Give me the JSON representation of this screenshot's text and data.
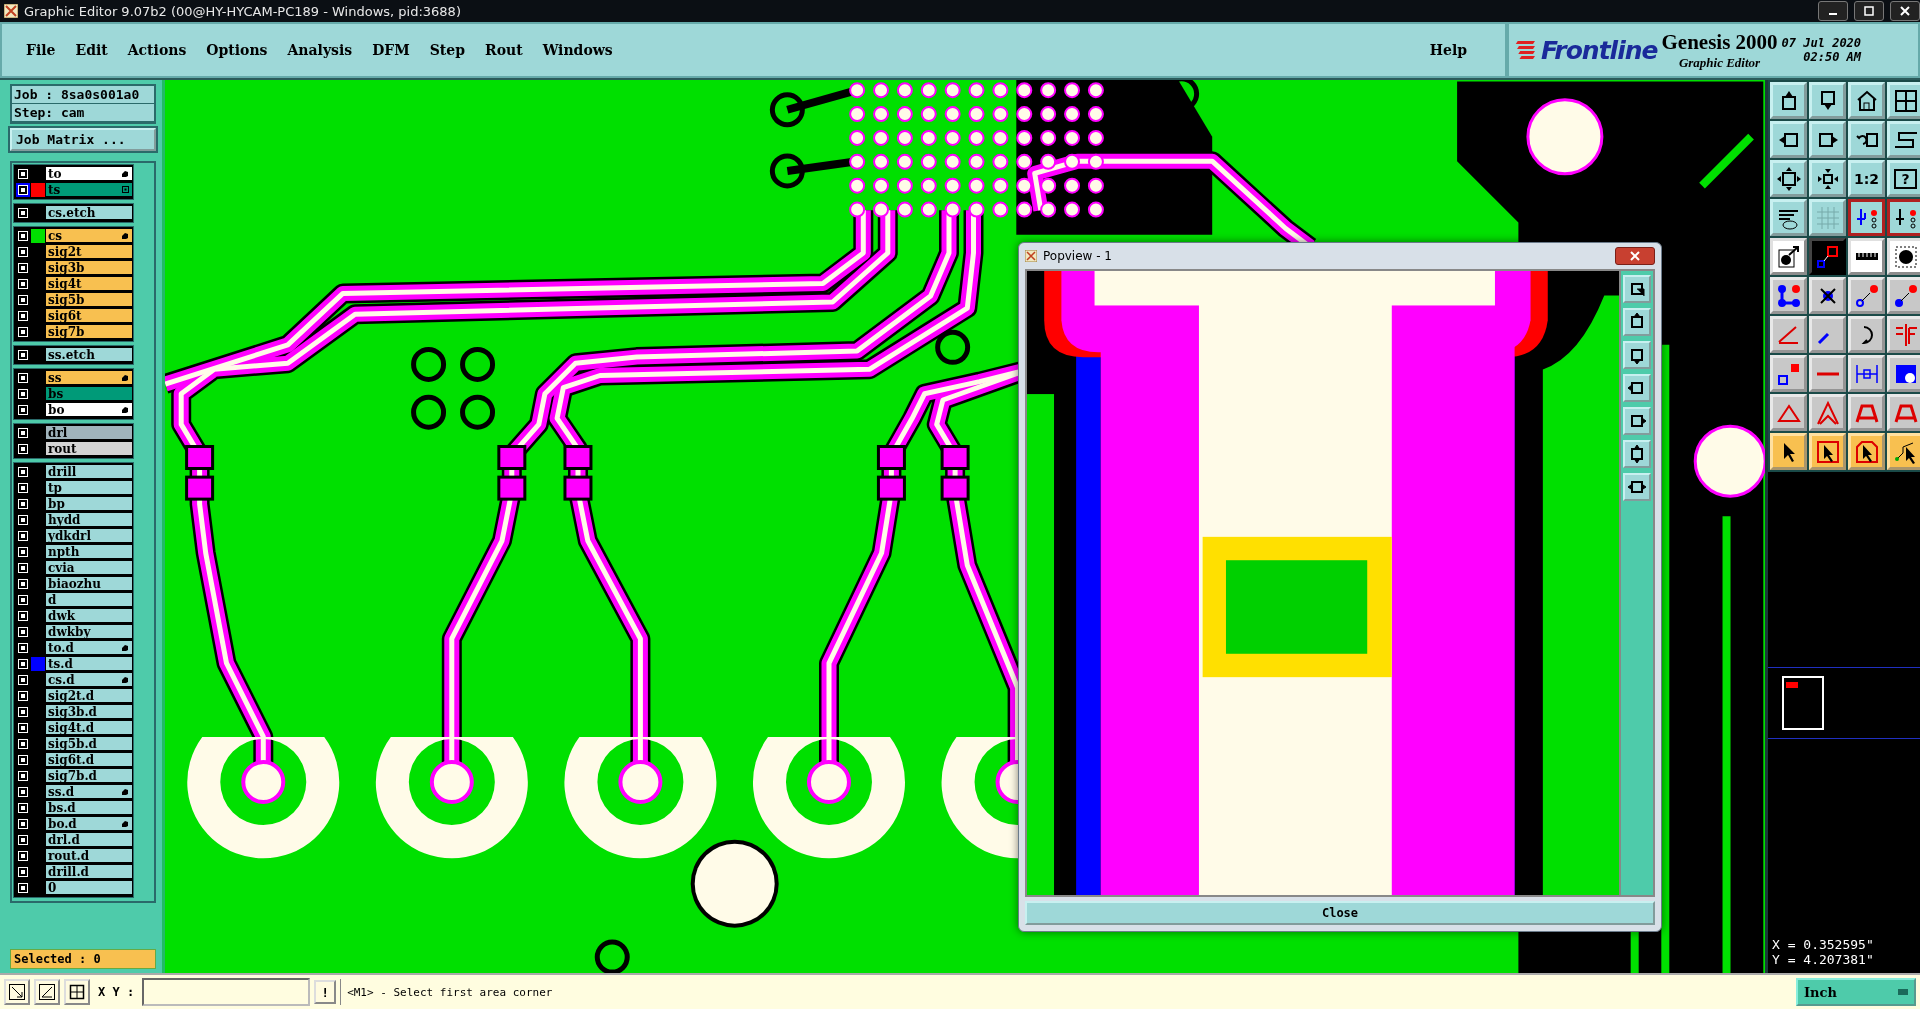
{
  "window": {
    "title": "Graphic Editor 9.07b2 (00@HY-HYCAM-PC189 - Windows, pid:3688)"
  },
  "menu": [
    "File",
    "Edit",
    "Actions",
    "Options",
    "Analysis",
    "DFM",
    "Step",
    "Rout",
    "Windows"
  ],
  "help_menu": "Help",
  "brand": {
    "logo": "Frontline",
    "product": "Genesis 2000",
    "subtitle": "Graphic Editor",
    "date": "07 Jul 2020",
    "time": "02:50 AM"
  },
  "job": {
    "job": "Job : 8sa0s001a0",
    "step": "Step: cam",
    "matrix_button": "Job Matrix ..."
  },
  "layer_groups": [
    {
      "layers": [
        {
          "name": "to",
          "kind": "silk",
          "checked": false,
          "selected": false,
          "hand": true,
          "grid_mark": false
        },
        {
          "name": "ts",
          "kind": "mask",
          "checked": false,
          "selected": true,
          "hand": false,
          "grid_mark": true,
          "color": "#ff0000"
        }
      ]
    },
    {
      "layers": [
        {
          "name": "cs.etch",
          "kind": "misc",
          "checked": false,
          "selected": false,
          "hand": false,
          "grid_mark": false
        }
      ]
    },
    {
      "layers": [
        {
          "name": "cs",
          "kind": "signal",
          "checked": false,
          "selected": false,
          "hand": true,
          "grid_mark": false,
          "color": "#00e000"
        },
        {
          "name": "sig2t",
          "kind": "signal",
          "checked": false,
          "selected": false,
          "hand": false,
          "grid_mark": false
        },
        {
          "name": "sig3b",
          "kind": "signal",
          "checked": false,
          "selected": false,
          "hand": false,
          "grid_mark": false
        },
        {
          "name": "sig4t",
          "kind": "signal",
          "checked": false,
          "selected": false,
          "hand": false,
          "grid_mark": false
        },
        {
          "name": "sig5b",
          "kind": "signal",
          "checked": false,
          "selected": false,
          "hand": false,
          "grid_mark": false
        },
        {
          "name": "sig6t",
          "kind": "signal",
          "checked": false,
          "selected": false,
          "hand": false,
          "grid_mark": false
        },
        {
          "name": "sig7b",
          "kind": "signal",
          "checked": false,
          "selected": false,
          "hand": false,
          "grid_mark": false
        }
      ]
    },
    {
      "layers": [
        {
          "name": "ss.etch",
          "kind": "misc",
          "checked": false,
          "selected": false,
          "hand": false,
          "grid_mark": false
        }
      ]
    },
    {
      "layers": [
        {
          "name": "ss",
          "kind": "signal",
          "checked": false,
          "selected": false,
          "hand": true,
          "grid_mark": false
        },
        {
          "name": "bs",
          "kind": "mask",
          "checked": false,
          "selected": false,
          "hand": false,
          "grid_mark": false
        },
        {
          "name": "bo",
          "kind": "silk",
          "checked": false,
          "selected": false,
          "hand": true,
          "grid_mark": false
        }
      ]
    },
    {
      "layers": [
        {
          "name": "drl",
          "kind": "drill",
          "checked": false,
          "selected": false,
          "hand": false,
          "grid_mark": false
        },
        {
          "name": "rout",
          "kind": "rout",
          "checked": false,
          "selected": false,
          "hand": false,
          "grid_mark": false
        }
      ]
    },
    {
      "layers": [
        {
          "name": "drill",
          "kind": "misc",
          "checked": false,
          "selected": false,
          "hand": false,
          "grid_mark": false
        },
        {
          "name": "tp",
          "kind": "misc",
          "checked": false,
          "selected": false,
          "hand": false,
          "grid_mark": false
        },
        {
          "name": "bp",
          "kind": "misc",
          "checked": false,
          "selected": false,
          "hand": false,
          "grid_mark": false
        },
        {
          "name": "hydd",
          "kind": "misc",
          "checked": false,
          "selected": false,
          "hand": false,
          "grid_mark": false
        },
        {
          "name": "ydkdrl",
          "kind": "misc",
          "checked": false,
          "selected": false,
          "hand": false,
          "grid_mark": false
        },
        {
          "name": "npth",
          "kind": "misc",
          "checked": false,
          "selected": false,
          "hand": false,
          "grid_mark": false
        },
        {
          "name": "cvia",
          "kind": "misc",
          "checked": false,
          "selected": false,
          "hand": false,
          "grid_mark": false
        },
        {
          "name": "biaozhu",
          "kind": "misc",
          "checked": false,
          "selected": false,
          "hand": false,
          "grid_mark": false
        },
        {
          "name": "d",
          "kind": "misc",
          "checked": false,
          "selected": false,
          "hand": false,
          "grid_mark": false
        },
        {
          "name": "dwk",
          "kind": "misc",
          "checked": false,
          "selected": false,
          "hand": false,
          "grid_mark": false
        },
        {
          "name": "dwkby",
          "kind": "misc",
          "checked": false,
          "selected": false,
          "hand": false,
          "grid_mark": false
        },
        {
          "name": "to.d",
          "kind": "misc",
          "checked": false,
          "selected": false,
          "hand": true,
          "grid_mark": false
        },
        {
          "name": "ts.d",
          "kind": "misc",
          "checked": false,
          "selected": false,
          "hand": false,
          "grid_mark": false,
          "color": "#0000ff"
        },
        {
          "name": "cs.d",
          "kind": "misc",
          "checked": false,
          "selected": false,
          "hand": true,
          "grid_mark": false
        },
        {
          "name": "sig2t.d",
          "kind": "misc",
          "checked": false,
          "selected": false,
          "hand": false,
          "grid_mark": false
        },
        {
          "name": "sig3b.d",
          "kind": "misc",
          "checked": false,
          "selected": false,
          "hand": false,
          "grid_mark": false
        },
        {
          "name": "sig4t.d",
          "kind": "misc",
          "checked": false,
          "selected": false,
          "hand": false,
          "grid_mark": false
        },
        {
          "name": "sig5b.d",
          "kind": "misc",
          "checked": false,
          "selected": false,
          "hand": false,
          "grid_mark": false
        },
        {
          "name": "sig6t.d",
          "kind": "misc",
          "checked": false,
          "selected": false,
          "hand": false,
          "grid_mark": false
        },
        {
          "name": "sig7b.d",
          "kind": "misc",
          "checked": false,
          "selected": false,
          "hand": false,
          "grid_mark": false
        },
        {
          "name": "ss.d",
          "kind": "misc",
          "checked": false,
          "selected": false,
          "hand": true,
          "grid_mark": false
        },
        {
          "name": "bs.d",
          "kind": "misc",
          "checked": false,
          "selected": false,
          "hand": false,
          "grid_mark": false
        },
        {
          "name": "bo.d",
          "kind": "misc",
          "checked": false,
          "selected": false,
          "hand": true,
          "grid_mark": false
        },
        {
          "name": "drl.d",
          "kind": "misc",
          "checked": false,
          "selected": false,
          "hand": false,
          "grid_mark": false
        },
        {
          "name": "rout.d",
          "kind": "misc",
          "checked": false,
          "selected": false,
          "hand": false,
          "grid_mark": false
        },
        {
          "name": "drill.d",
          "kind": "misc",
          "checked": false,
          "selected": false,
          "hand": false,
          "grid_mark": false
        },
        {
          "name": "0",
          "kind": "misc",
          "checked": false,
          "selected": false,
          "hand": false,
          "grid_mark": false
        }
      ]
    }
  ],
  "selected_count": "Selected : 0",
  "toolbar": {
    "ratio_button": "1:2",
    "help_button": "?"
  },
  "popview": {
    "title": "Popview - 1",
    "close_button": "Close"
  },
  "coordinates": {
    "x": "X = 0.352595\"",
    "y": "Y = 4.207381\""
  },
  "status_bar": {
    "xy_label": "X Y :",
    "alert_button": "!",
    "message": "<M1> - Select first area corner",
    "units": "Inch"
  }
}
